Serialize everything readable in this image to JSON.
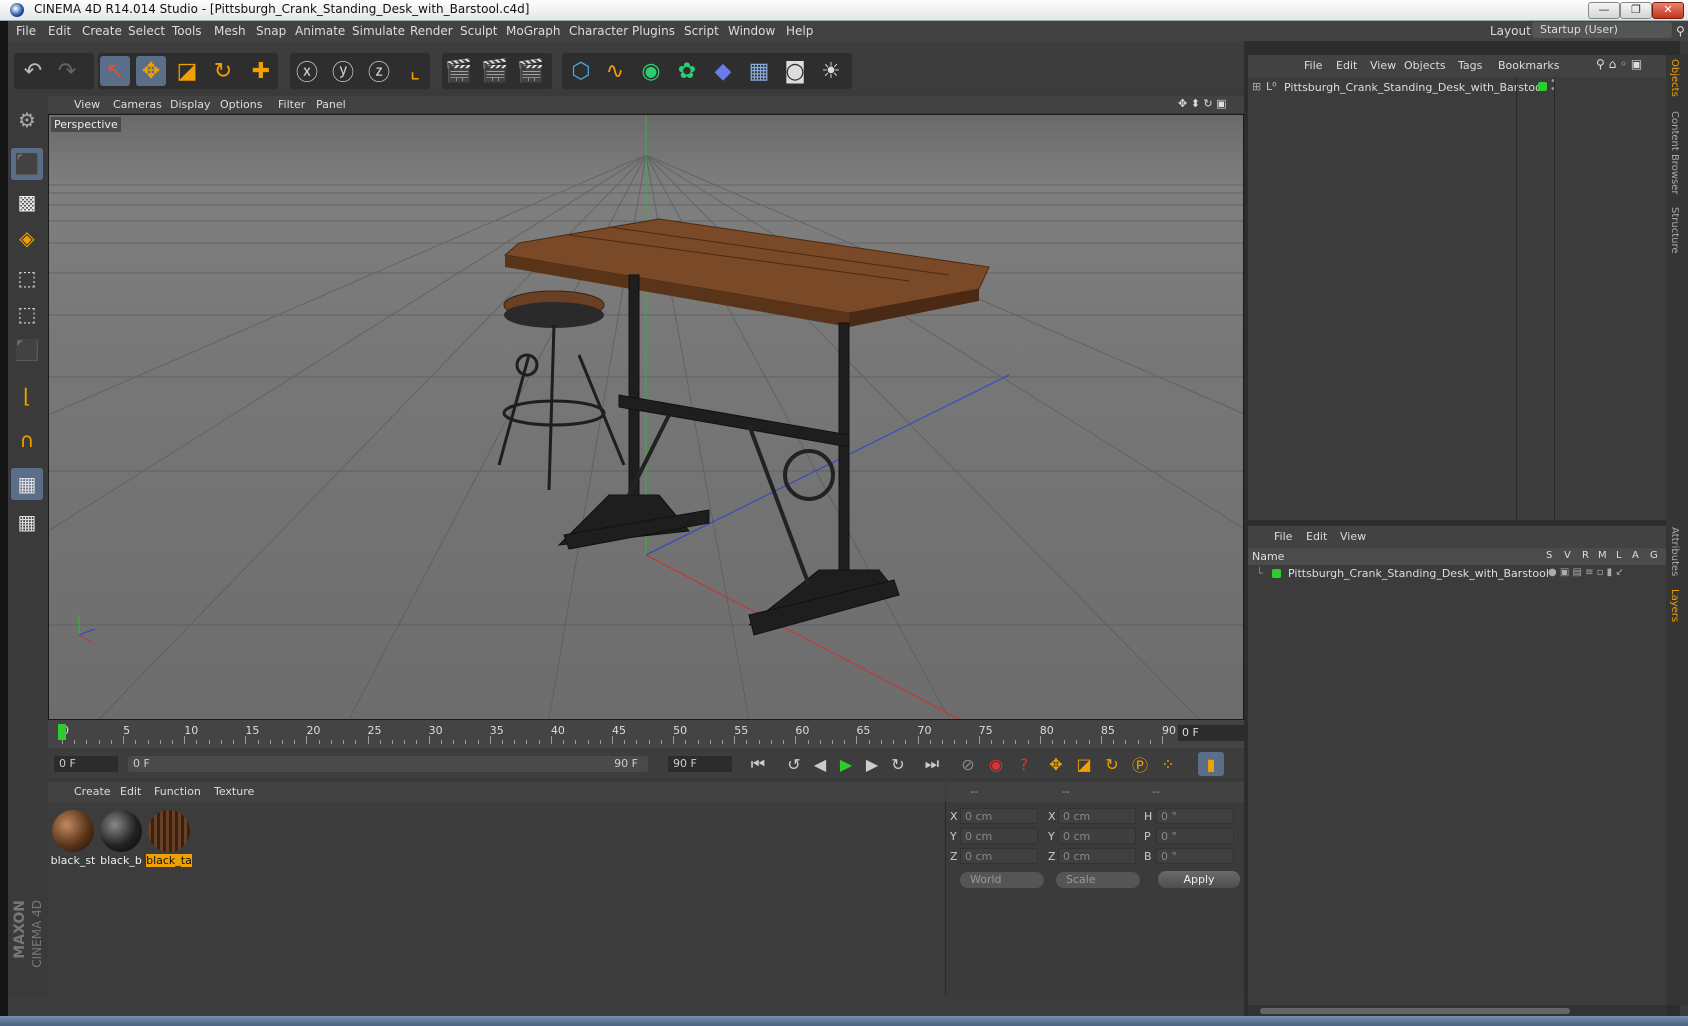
{
  "window": {
    "title": "CINEMA 4D R14.014 Studio - [Pittsburgh_Crank_Standing_Desk_with_Barstool.c4d]",
    "minimize": "—",
    "restore": "❐",
    "close": "✕"
  },
  "menubar": [
    "File",
    "Edit",
    "Create",
    "Select",
    "Tools",
    "Mesh",
    "Snap",
    "Animate",
    "Simulate",
    "Render",
    "Sculpt",
    "MoGraph",
    "Character",
    "Plugins",
    "Script",
    "Window",
    "Help"
  ],
  "layout": {
    "label": "Layout:",
    "value": "Startup (User)"
  },
  "viewport": {
    "menu": [
      "View",
      "Cameras",
      "Display",
      "Options",
      "Filter",
      "Panel"
    ],
    "camera_label": "Perspective"
  },
  "timeline": {
    "ticks": [
      "0",
      "5",
      "10",
      "15",
      "20",
      "25",
      "30",
      "35",
      "40",
      "45",
      "50",
      "55",
      "60",
      "65",
      "70",
      "75",
      "80",
      "85",
      "90"
    ],
    "current_frame": "0 F",
    "start_field": "0 F",
    "range_start": "0 F",
    "range_end": "90 F",
    "end_field": "90 F"
  },
  "material_manager": {
    "menu": [
      "Create",
      "Edit",
      "Function",
      "Texture"
    ],
    "materials": [
      {
        "label": "black_st"
      },
      {
        "label": "black_b"
      },
      {
        "label": "black_ta"
      }
    ]
  },
  "coordinates": {
    "headers": [
      "--",
      "--",
      "--"
    ],
    "rows": [
      {
        "a_label": "X",
        "a_val": "0 cm",
        "b_label": "X",
        "b_val": "0 cm",
        "c_label": "H",
        "c_val": "0 °"
      },
      {
        "a_label": "Y",
        "a_val": "0 cm",
        "b_label": "Y",
        "b_val": "0 cm",
        "c_label": "P",
        "c_val": "0 °"
      },
      {
        "a_label": "Z",
        "a_val": "0 cm",
        "b_label": "Z",
        "b_val": "0 cm",
        "c_label": "B",
        "c_val": "0 °"
      }
    ],
    "world": "World",
    "scale": "Scale",
    "apply": "Apply"
  },
  "object_manager": {
    "menu": [
      "File",
      "Edit",
      "View",
      "Objects",
      "Tags",
      "Bookmarks"
    ],
    "object_name": "Pittsburgh_Crank_Standing_Desk_with_Barstool"
  },
  "layer_manager": {
    "menu": [
      "File",
      "Edit",
      "View"
    ],
    "columns": [
      "Name",
      "S",
      "V",
      "R",
      "M",
      "L",
      "A",
      "G"
    ],
    "layer_name": "Pittsburgh_Crank_Standing_Desk_with_Barstool"
  },
  "right_tabs": [
    "Objects",
    "Content Browser",
    "Structure",
    "Attributes",
    "Layers"
  ],
  "branding": {
    "line1": "MAXON",
    "line2": "CINEMA 4D"
  },
  "colors": {
    "accent": "#f0a000",
    "green": "#2ecc2e",
    "wood": "#7a4a28"
  }
}
